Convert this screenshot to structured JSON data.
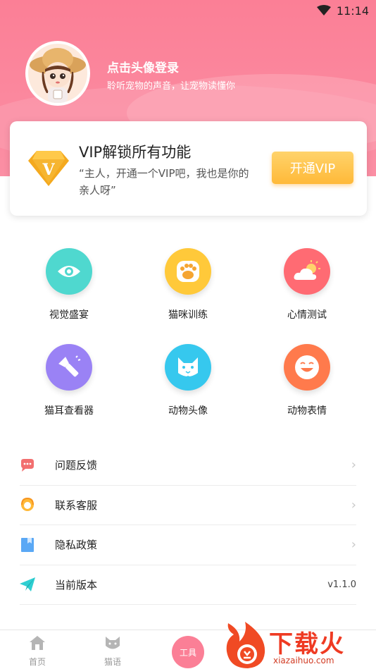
{
  "status_bar": {
    "time": "11:14",
    "icons": [
      "wifi-icon"
    ]
  },
  "profile": {
    "login_title": "点击头像登录",
    "login_subtitle": "聆听宠物的声音，让宠物读懂你"
  },
  "vip": {
    "title": "VIP解锁所有功能",
    "description": "“主人，开通一个VIP吧，我也是你的亲人呀”",
    "button_label": "开通VIP",
    "badge_letter": "V",
    "colors": {
      "button": "#ffbf44",
      "badge": "#f4a91e"
    }
  },
  "grid": {
    "items": [
      {
        "label": "视觉盛宴",
        "icon": "eye-icon",
        "color": "#4fd8cf"
      },
      {
        "label": "猫咪训练",
        "icon": "paw-icon",
        "color": "#ffc93a"
      },
      {
        "label": "心情测试",
        "icon": "weather-icon",
        "color": "#ff6b73"
      },
      {
        "label": "猫耳查看器",
        "icon": "flashlight-icon",
        "color": "#9a82f5"
      },
      {
        "label": "动物头像",
        "icon": "cat-face-icon",
        "color": "#36c8ee"
      },
      {
        "label": "动物表情",
        "icon": "smile-icon",
        "color": "#ff7a4c"
      }
    ]
  },
  "menu": {
    "items": [
      {
        "label": "问题反馈",
        "icon": "chat-bubble-icon"
      },
      {
        "label": "联系客服",
        "icon": "customer-service-icon"
      },
      {
        "label": "隐私政策",
        "icon": "bookmark-icon"
      },
      {
        "label": "当前版本",
        "icon": "paper-plane-icon",
        "value": "v1.1.0"
      }
    ]
  },
  "bottom_nav": {
    "home": "首页",
    "cat_language": "猫语",
    "tools": "工具"
  },
  "watermark": {
    "text": "下载火",
    "url": "xiazaihuo.com"
  },
  "theme": {
    "primary": "#fb7f96"
  }
}
